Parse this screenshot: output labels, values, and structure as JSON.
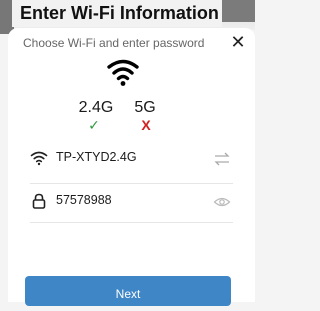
{
  "dialog": {
    "title": "Enter Wi-Fi Information",
    "subtitle": "Choose Wi-Fi and enter password",
    "close_icon": "close-icon"
  },
  "band": {
    "option_24": {
      "label": "2.4G",
      "mark": "✓",
      "supported": true
    },
    "option_5": {
      "label": "5G",
      "mark": "X",
      "supported": false
    }
  },
  "form": {
    "ssid": {
      "value": "TP-XTYD2.4G",
      "icon": "wifi-icon",
      "action_icon": "swap-icon"
    },
    "password": {
      "value": "57578988",
      "icon": "lock-icon",
      "action_icon": "eye-icon"
    }
  },
  "next_label": "Next",
  "colors": {
    "accent": "#3f86c7",
    "check": "#2e9b3c",
    "cross": "#d02020"
  }
}
